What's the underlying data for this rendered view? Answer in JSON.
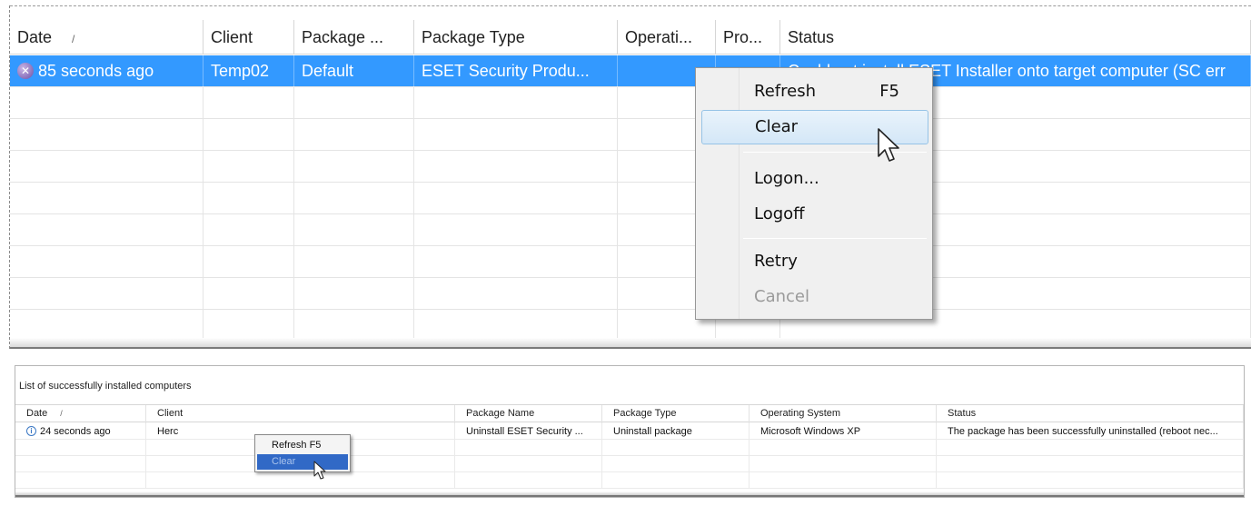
{
  "top_table": {
    "columns": [
      "Date",
      "Client",
      "Package ...",
      "Package Type",
      "Operati...",
      "Pro...",
      "Status"
    ],
    "sort_indicator": "/",
    "rows": [
      {
        "date": "85 seconds ago",
        "client": "Temp02",
        "package": "Default",
        "package_type": "ESET Security Produ...",
        "operating": "",
        "pro": "",
        "status": "Could not install ESET Installer onto target computer (SC err",
        "icon": "error-icon"
      }
    ]
  },
  "context_menu": {
    "items": [
      {
        "label": "Refresh",
        "key": "F5",
        "state": "normal"
      },
      {
        "label": "Clear",
        "key": "",
        "state": "hover"
      },
      {
        "label": "Logon...",
        "key": "",
        "state": "normal"
      },
      {
        "label": "Logoff",
        "key": "",
        "state": "normal"
      },
      {
        "label": "Retry",
        "key": "",
        "state": "normal"
      },
      {
        "label": "Cancel",
        "key": "",
        "state": "disabled"
      }
    ]
  },
  "bottom_table": {
    "title": "List of successfully installed computers",
    "columns": [
      "Date",
      "Client",
      "Package Name",
      "Package Type",
      "Operating System",
      "Status"
    ],
    "sort_indicator": "/",
    "rows": [
      {
        "date": "24 seconds ago",
        "client": "Herc",
        "package_name": "Uninstall ESET Security ...",
        "package_type": "Uninstall package",
        "os": "Microsoft Windows XP",
        "status": "The package has been successfully uninstalled (reboot nec...",
        "icon": "info-icon"
      }
    ]
  },
  "mini_context_menu": {
    "items": [
      {
        "label": "Refresh  F5",
        "state": "normal"
      },
      {
        "label": "Clear",
        "state": "highlighted"
      }
    ]
  },
  "colors": {
    "selection": "#3399ff",
    "menu_hover": "#d4e7f7",
    "mini_highlight": "#3169c6"
  }
}
